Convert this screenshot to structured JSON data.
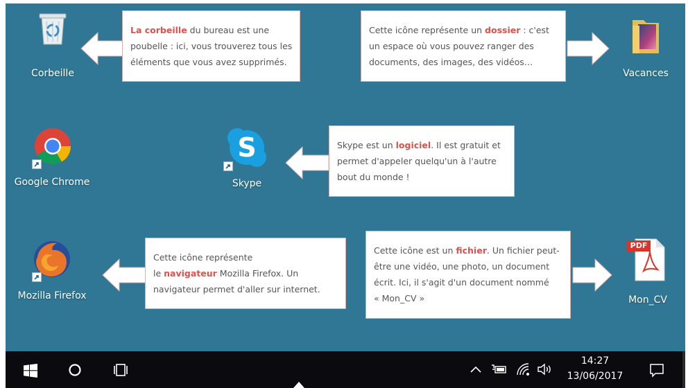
{
  "desktop": {
    "background_color": "#2f7794",
    "icons": [
      {
        "label": "Corbeille",
        "icon": "recycle-bin-icon"
      },
      {
        "label": "Vacances",
        "icon": "folder-icon"
      },
      {
        "label": "Google Chrome",
        "icon": "chrome-icon"
      },
      {
        "label": "Skype",
        "icon": "skype-icon"
      },
      {
        "label": "Mozilla Firefox",
        "icon": "firefox-icon"
      },
      {
        "label": "Mon_CV",
        "icon": "pdf-icon",
        "badge": "PDF"
      }
    ]
  },
  "callouts": {
    "recycle": {
      "highlight": "La corbeille",
      "line1_rest": " du bureau est une",
      "line2": "poubelle : ici, vous trouverez tous les",
      "line3": "éléments que vous avez supprimés."
    },
    "folder": {
      "line1_pre": "Cette icône représente un ",
      "highlight": "dossier",
      "line1_post": " : c'est",
      "line2": "un espace où vous pouvez ranger des",
      "line3": "documents, des images, des vidéos…"
    },
    "skype": {
      "line1_pre": "Skype est un ",
      "highlight": "logiciel",
      "line1_post": ". Il est gratuit et",
      "line2": "permet d'appeler quelqu'un à l'autre",
      "line3": "bout du monde !"
    },
    "firefox": {
      "line1": "Cette icône représente",
      "line2_pre": "le ",
      "highlight": "navigateur",
      "line2_post": " Mozilla Firefox. Un",
      "line3": "navigateur permet d'aller sur internet."
    },
    "file": {
      "line1_pre": "Cette icône est un ",
      "highlight": "fichier",
      "line1_post": ". Un fichier peut-",
      "line2": "être une vidéo, une photo, un document",
      "line3": "écrit. Ici, il s'agit d'un document nommé",
      "line4": "« Mon_CV »"
    }
  },
  "taskbar": {
    "buttons": [
      "start-button",
      "cortana-button",
      "task-view-button"
    ],
    "tray_icons": [
      "chevron-up-icon",
      "battery-icon",
      "wifi-icon",
      "volume-icon"
    ],
    "time": "14:27",
    "date": "13/06/2017",
    "notification": "action-center-icon"
  }
}
